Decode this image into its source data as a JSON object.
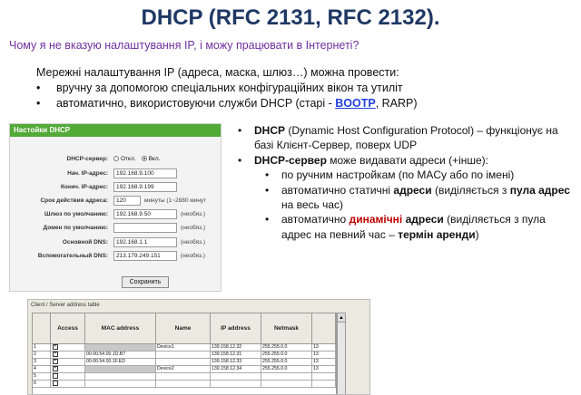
{
  "slide": {
    "title": "DHCP (RFC 2131, RFC 2132).",
    "subtitle": "Чому я не вказую налаштування IP, і можу працювати в Інтернеті?"
  },
  "intro": {
    "line1": "Мережні налаштування IP (адреса, маска, шлюз…) можна провести:",
    "bullet1": "вручну за допомогою спеціальних конфігураційних вікон та утиліт",
    "bullet2_pre": "автоматично, використовуючи служби DHCP (старі - ",
    "bullet2_link": "BOOTP",
    "bullet2_post": ", RARP)"
  },
  "dhcp_panel": {
    "header": "Настойки DHCP",
    "server_label": "DHCP-сервер:",
    "opt_off": "Откл.",
    "opt_on": "Вкл.",
    "start_label": "Нач. IP-адрес:",
    "start_value": "192.168.9.100",
    "end_label": "Конеч. IP-адрес:",
    "end_value": "192.168.9.199",
    "lease_label": "Срок действия адреса:",
    "lease_value": "120",
    "lease_note": "минуты (1~2880 минут",
    "gateway_label": "Шлюз по умолчанию:",
    "gateway_value": "192.168.9.50",
    "domain_label": "Домен по умолчанию:",
    "domain_value": "",
    "dns1_label": "Основной DNS:",
    "dns1_value": "192.168.1.1",
    "dns2_label": "Вспомогательный DNS:",
    "dns2_value": "213.179.249.151",
    "optional": "(необяз.)",
    "save_label": "Сохранить"
  },
  "right_text": {
    "p1_bold": "DHCP",
    "p1_rest": " (Dynamic Host Configuration Protocol) – функціонує на базі Клієнт-Сервер,  поверх UDP",
    "p2_bold": "DHCP-сервер",
    "p2_rest": " може видавати адреси (+інше):",
    "s1": "по ручним настройкам (по MACу або по імені)",
    "s2_pre": "автоматично статичні ",
    "s2_b1": "адреси",
    "s2_mid": " (виділяється з ",
    "s2_b2": "пула адрес",
    "s2_post": " на весь час)",
    "s3_pre": "автоматично ",
    "s3_b1": "динамічні",
    "s3_b2": " адреси",
    "s3_mid": " (виділяється з пула адрес на певний час – ",
    "s3_b3": "термін аренди",
    "s3_post": ")"
  },
  "address_table": {
    "caption": "Client / Server address table",
    "columns": [
      "Access",
      "MAC address",
      "Name",
      "IP address",
      "Netmask"
    ],
    "rows": [
      {
        "n": "1",
        "access": true,
        "mac": "",
        "mac_gray": true,
        "name": "Device1",
        "ip": "139.158.12.32",
        "mask": "255.255.0.0",
        "extra": "13"
      },
      {
        "n": "2",
        "access": true,
        "mac": "00.00.54.00.1D.B7",
        "mac_gray": false,
        "name": "",
        "ip": "139.158.12.31",
        "mask": "255.255.0.0",
        "extra": "13"
      },
      {
        "n": "3",
        "access": true,
        "mac": "00.00.54.00.1F.ED",
        "mac_gray": false,
        "name": "",
        "ip": "139.158.12.33",
        "mask": "255.255.0.0",
        "extra": "13"
      },
      {
        "n": "4",
        "access": true,
        "mac": "",
        "mac_gray": true,
        "name": "Device2",
        "ip": "139.158.12.34",
        "mask": "255.255.0.0",
        "extra": "13"
      },
      {
        "n": "5",
        "access": false,
        "mac": "",
        "mac_gray": false,
        "name": "",
        "ip": "",
        "mask": "",
        "extra": ""
      },
      {
        "n": "6",
        "access": false,
        "mac": "",
        "mac_gray": false,
        "name": "",
        "ip": "",
        "mask": "",
        "extra": ""
      }
    ]
  }
}
